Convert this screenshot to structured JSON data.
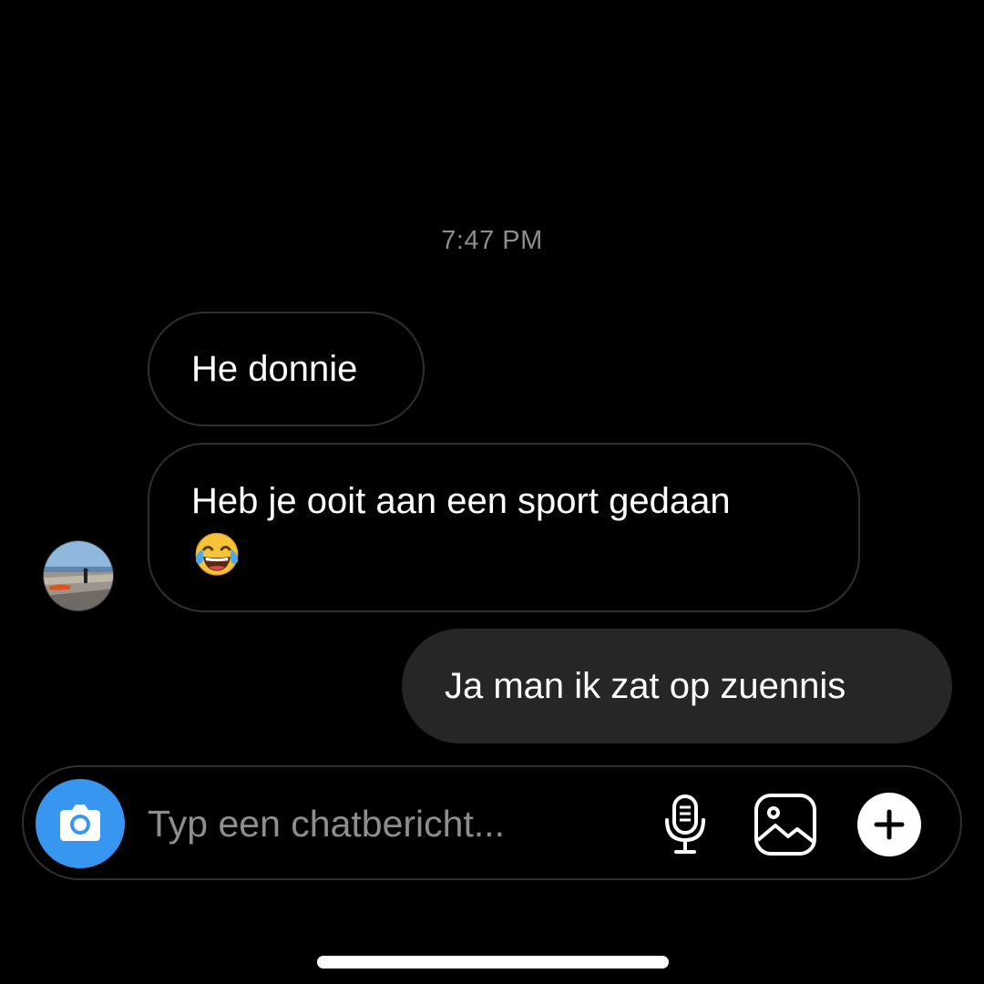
{
  "conversation": {
    "timestamp": "7:47 PM",
    "messages": [
      {
        "sender": "other",
        "text": "He donnie"
      },
      {
        "sender": "other",
        "text": "Heb je ooit aan een sport gedaan",
        "emoji": "face-with-tears-of-joy"
      },
      {
        "sender": "self",
        "text": "Ja man ik zat op zuennis"
      }
    ]
  },
  "composer": {
    "placeholder": "Typ een chatbericht...",
    "value": "",
    "icons": [
      "camera-icon",
      "microphone-icon",
      "image-gallery-icon",
      "plus-icon"
    ]
  },
  "colors": {
    "background": "#000000",
    "accent": "#3797f0",
    "outgoing_bubble": "#262626",
    "incoming_border": "#2f2f2f",
    "muted_text": "#8e8e8e"
  }
}
